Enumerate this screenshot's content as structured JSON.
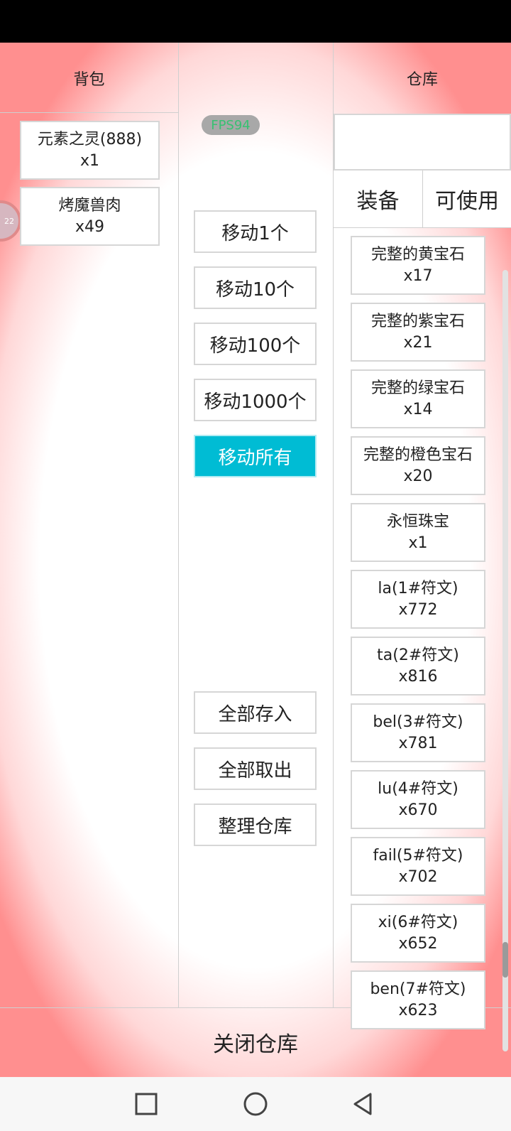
{
  "hud": {
    "fps_label": "FPS94",
    "avatar_badge": "22"
  },
  "backpack": {
    "title": "背包",
    "items": [
      {
        "name": "元素之灵(888)",
        "count": "x1"
      },
      {
        "name": "烤魔兽肉",
        "count": "x49"
      }
    ]
  },
  "actions": {
    "move_buttons": [
      "移动1个",
      "移动10个",
      "移动100个",
      "移动1000个",
      "移动所有"
    ],
    "active_move_index": 4,
    "deposit_all": "全部存入",
    "withdraw_all": "全部取出",
    "sort_warehouse": "整理仓库"
  },
  "warehouse": {
    "title": "仓库",
    "search_value": "",
    "tabs": [
      "装备",
      "可使用"
    ],
    "items": [
      {
        "name": "完整的黄宝石",
        "count": "x17"
      },
      {
        "name": "完整的紫宝石",
        "count": "x21"
      },
      {
        "name": "完整的绿宝石",
        "count": "x14"
      },
      {
        "name": "完整的橙色宝石",
        "count": "x20"
      },
      {
        "name": "永恒珠宝",
        "count": "x1"
      },
      {
        "name": "la(1#符文)",
        "count": "x772"
      },
      {
        "name": "ta(2#符文)",
        "count": "x816"
      },
      {
        "name": "bel(3#符文)",
        "count": "x781"
      },
      {
        "name": "lu(4#符文)",
        "count": "x670"
      },
      {
        "name": "fail(5#符文)",
        "count": "x702"
      },
      {
        "name": "xi(6#符文)",
        "count": "x652"
      },
      {
        "name": "ben(7#符文)",
        "count": "x623"
      }
    ]
  },
  "footer": {
    "close_label": "关闭仓库"
  },
  "system_nav": {
    "icons": [
      "recents-square-icon",
      "home-circle-icon",
      "back-triangle-icon"
    ]
  },
  "colors": {
    "accent": "#00bcd4",
    "fps_text": "#38c172",
    "edge_glow": "#ff8f8f"
  }
}
